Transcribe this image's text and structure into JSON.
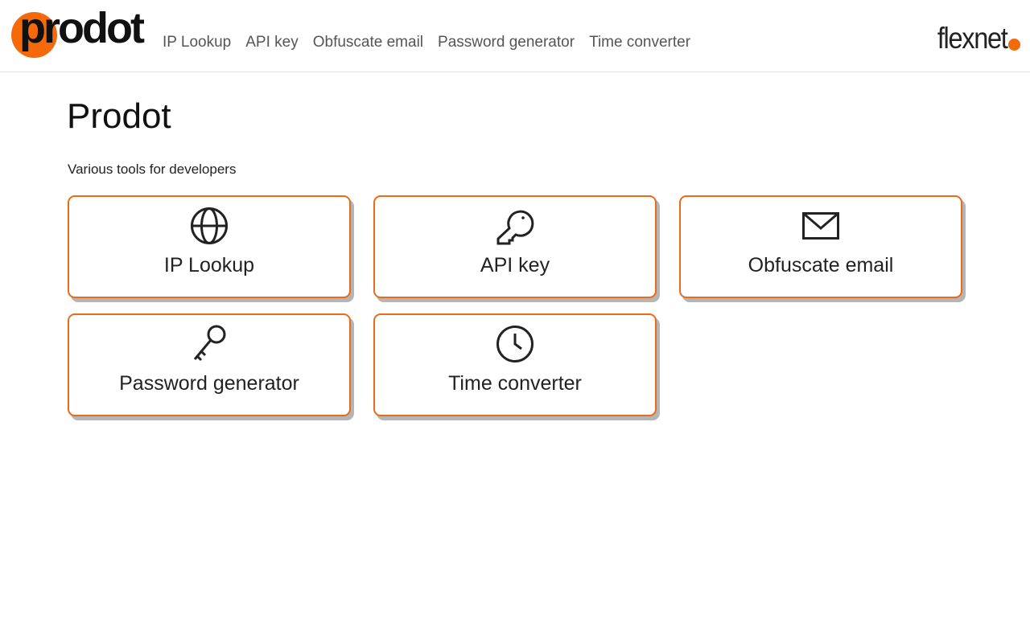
{
  "header": {
    "logo_text": "prodot",
    "brand_text": "flexnet",
    "accent_color": "#f46a0a",
    "nav": [
      {
        "label": "IP Lookup"
      },
      {
        "label": "API key"
      },
      {
        "label": "Obfuscate email"
      },
      {
        "label": "Password generator"
      },
      {
        "label": "Time converter"
      }
    ]
  },
  "main": {
    "title": "Prodot",
    "subtitle": "Various tools for developers",
    "cards": [
      {
        "label": "IP Lookup",
        "icon": "globe-icon"
      },
      {
        "label": "API key",
        "icon": "key-icon"
      },
      {
        "label": "Obfuscate email",
        "icon": "envelope-icon"
      },
      {
        "label": "Password generator",
        "icon": "key-icon"
      },
      {
        "label": "Time converter",
        "icon": "clock-icon"
      }
    ]
  }
}
